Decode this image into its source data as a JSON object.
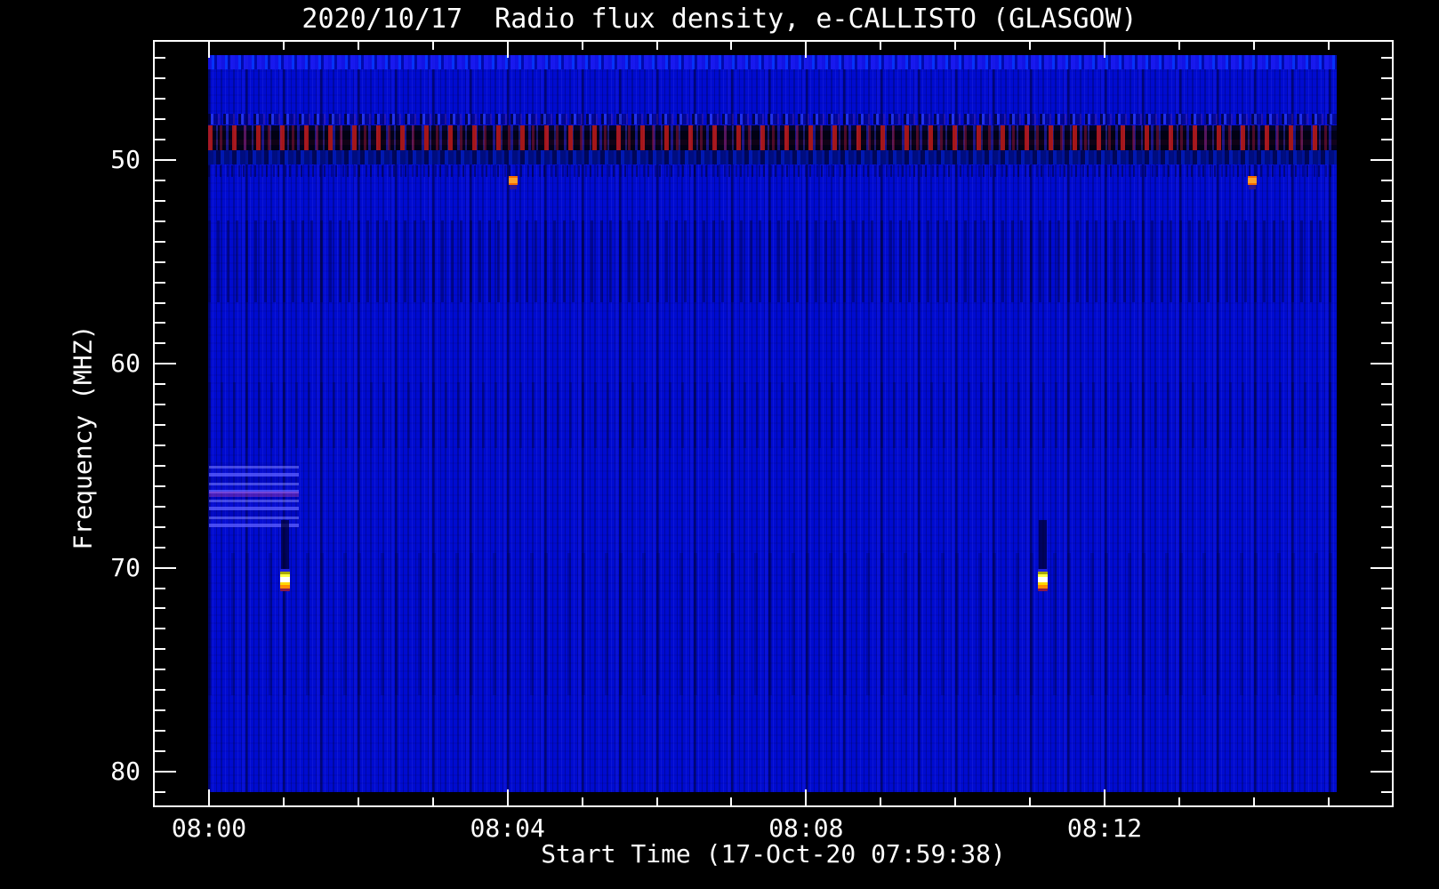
{
  "chart_data": {
    "type": "heatmap",
    "title": "2020/10/17  Radio flux density, e-CALLISTO (GLASGOW)",
    "xlabel": "Start Time (17-Oct-20 07:59:38)",
    "ylabel": "Frequency (MHZ)",
    "x_axis": {
      "major_ticks": [
        {
          "label": "08:00",
          "minute": 0
        },
        {
          "label": "08:04",
          "minute": 4
        },
        {
          "label": "08:08",
          "minute": 8
        },
        {
          "label": "08:12",
          "minute": 12
        }
      ],
      "minor_tick_minutes": [
        1,
        2,
        3,
        5,
        6,
        7,
        9,
        10,
        11,
        13,
        14,
        15
      ],
      "time_range": [
        "07:59:38",
        "08:15:06"
      ]
    },
    "y_axis": {
      "major_ticks": [
        {
          "label": "50",
          "mhz": 50
        },
        {
          "label": "60",
          "mhz": 60
        },
        {
          "label": "70",
          "mhz": 70
        },
        {
          "label": "80",
          "mhz": 80
        }
      ],
      "minor_tick_mhz": [
        45,
        46,
        47,
        48,
        49,
        51,
        52,
        53,
        54,
        55,
        56,
        57,
        58,
        59,
        61,
        62,
        63,
        64,
        65,
        66,
        67,
        68,
        69,
        71,
        72,
        73,
        74,
        75,
        76,
        77,
        78,
        79,
        81
      ],
      "range_mhz": [
        44.9,
        81.1
      ],
      "inverted": true
    },
    "features": {
      "interference_band": {
        "freq_mhz": [
          48.3,
          49.5
        ],
        "desc": "persistent RFI band of dark and red blotches across full time range"
      },
      "bright_streaks": {
        "minute_range": [
          0,
          1.2
        ],
        "freq_mhz": [
          64.9,
          68.0
        ],
        "desc": "light-blue horizontal streaks near start of recording"
      },
      "bursts": [
        {
          "kind": "saturated",
          "minute": 1.01,
          "freq_mhz": 70.6,
          "desc": "white/yellow/orange point burst"
        },
        {
          "kind": "saturated",
          "minute": 11.17,
          "freq_mhz": 70.6,
          "desc": "white/yellow/orange point burst"
        },
        {
          "kind": "spot",
          "minute": 4.08,
          "freq_mhz": 51.0,
          "desc": "orange point spot"
        },
        {
          "kind": "spot",
          "minute": 13.98,
          "freq_mhz": 51.0,
          "desc": "orange point spot"
        }
      ]
    },
    "colors": {
      "background": "#000000",
      "axis": "#ffffff",
      "base_blue": "#000bd0",
      "rfi_red": "#b91919",
      "burst_white": "#ffffff",
      "burst_yellow": "#ffd800",
      "burst_orange": "#ff8c00"
    }
  }
}
